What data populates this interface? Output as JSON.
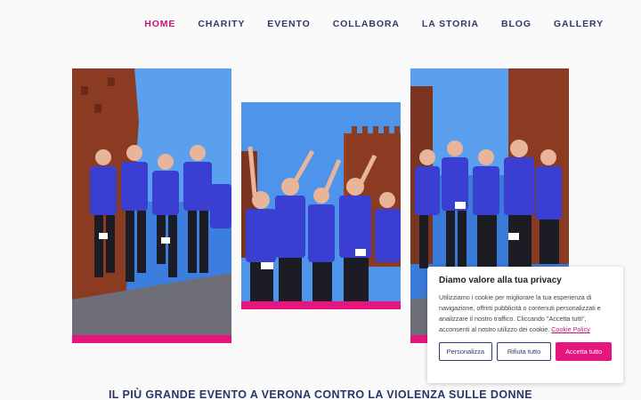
{
  "nav": {
    "items": [
      "HOME",
      "CHARITY",
      "EVENTO",
      "COLLABORA",
      "LA STORIA",
      "BLOG",
      "GALLERY"
    ],
    "active": "HOME"
  },
  "photos": [
    {
      "name": "photo-left"
    },
    {
      "name": "photo-center"
    },
    {
      "name": "photo-right"
    }
  ],
  "headline": "IL PIÙ GRANDE EVENTO A VERONA CONTRO LA VIOLENZA SULLE DONNE",
  "cookie": {
    "title": "Diamo valore alla tua privacy",
    "text": "Utilizziamo i cookie per migliorare la tua esperienza di navigazione, offrirti pubblicità o contenuti personalizzati e analizzare il nostro traffico. Cliccando \"Accetta tutti\", acconsenti al nostro utilizzo dei cookie.",
    "policy_link": "Cookie Policy",
    "buttons": {
      "customize": "Personalizza",
      "reject": "Rifiuta tutto",
      "accept": "Accetta tutto"
    }
  },
  "colors": {
    "accent": "#e6157e",
    "nav_text": "#2f3a6b",
    "active": "#c2157a"
  }
}
